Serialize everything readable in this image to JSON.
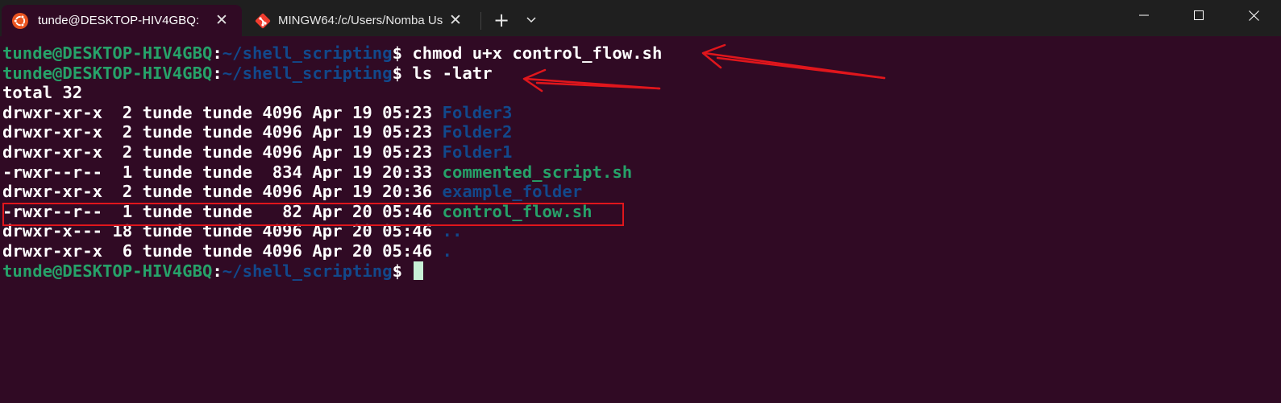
{
  "tabs": [
    {
      "title": "tunde@DESKTOP-HIV4GBQ: ~",
      "close": "✕"
    },
    {
      "title": "MINGW64:/c/Users/Nomba Us",
      "close": "✕"
    }
  ],
  "new_tab": "+",
  "window_controls": {
    "minimize": "─",
    "maximize": "☐",
    "close": "✕"
  },
  "prompt": {
    "user": "tunde@DESKTOP-HIV4GBQ",
    "colon": ":",
    "path": "~/shell_scripting",
    "dollar": "$ "
  },
  "commands": [
    "chmod u+x control_flow.sh",
    "ls -latr"
  ],
  "total": "total 32",
  "listing": [
    {
      "meta": "drwxr-xr-x  2 tunde tunde 4096 Apr 19 05:23 ",
      "name": "Folder3",
      "kind": "dir"
    },
    {
      "meta": "drwxr-xr-x  2 tunde tunde 4096 Apr 19 05:23 ",
      "name": "Folder2",
      "kind": "dir"
    },
    {
      "meta": "drwxr-xr-x  2 tunde tunde 4096 Apr 19 05:23 ",
      "name": "Folder1",
      "kind": "dir"
    },
    {
      "meta": "-rwxr--r--  1 tunde tunde  834 Apr 19 20:33 ",
      "name": "commented_script.sh",
      "kind": "exec"
    },
    {
      "meta": "drwxr-xr-x  2 tunde tunde 4096 Apr 19 20:36 ",
      "name": "example_folder",
      "kind": "dir"
    },
    {
      "meta": "-rwxr--r--  1 tunde tunde   82 Apr 20 05:46 ",
      "name": "control_flow.sh",
      "kind": "exec"
    },
    {
      "meta": "drwxr-x--- 18 tunde tunde 4096 Apr 20 05:46 ",
      "name": "..",
      "kind": "dir"
    },
    {
      "meta": "drwxr-xr-x  6 tunde tunde 4096 Apr 20 05:46 ",
      "name": ".",
      "kind": "dir"
    }
  ],
  "colors": {
    "terminal_bg": "#300a24",
    "titlebar_bg": "#1f1f1f",
    "prompt_user": "#26a269",
    "prompt_path": "#12488b",
    "directory": "#12488b",
    "executable": "#26a269",
    "annotation_red": "#e0161c"
  },
  "icons": {
    "tab1": "ubuntu-logo-icon",
    "tab2": "git-logo-icon"
  }
}
